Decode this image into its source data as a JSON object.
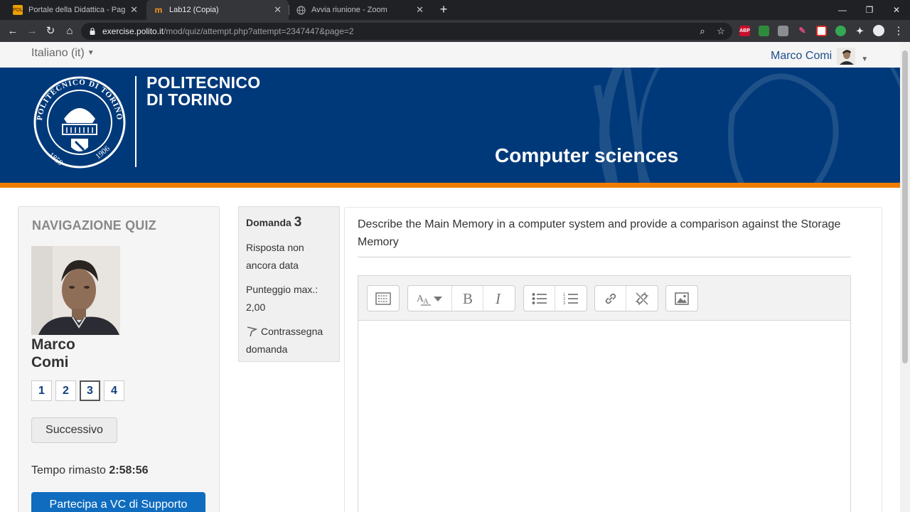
{
  "browser": {
    "tabs": [
      {
        "title": "Portale della Didattica - Pagina di",
        "favicon": "POL",
        "active": false
      },
      {
        "title": "Lab12 (Copia)",
        "favicon": "m",
        "active": true
      },
      {
        "title": "Avvia riunione - Zoom",
        "favicon": "globe-icon",
        "active": false
      }
    ],
    "url_host": "exercise.polito.it",
    "url_path": "/mod/quiz/attempt.php?attempt=2347447&page=2"
  },
  "topbar": {
    "language": "Italiano (it)",
    "user_name": "Marco Comi"
  },
  "banner": {
    "org_line1": "POLITECNICO",
    "org_line2": "DI TORINO",
    "seal_text": "POLITECNICO DI TORINO",
    "seal_year_left": "1859",
    "seal_year_right": "1906",
    "course_title": "Computer sciences",
    "brand_color": "#003979",
    "stripe_color": "#ef7d00"
  },
  "quiz_nav": {
    "heading": "NAVIGAZIONE QUIZ",
    "student_first": "Marco",
    "student_last": "Comi",
    "questions": [
      "1",
      "2",
      "3",
      "4"
    ],
    "current_question": "3",
    "next_label": "Successivo",
    "timer_label": "Tempo rimasto",
    "timer_value": "2:58:56",
    "vc_button": "Partecipa a VC di Supporto"
  },
  "question_info": {
    "label": "Domanda",
    "number": "3",
    "state": "Risposta non ancora data",
    "grade": "Punteggio max.: 2,00",
    "flag": "Contrassegna domanda"
  },
  "question": {
    "text": "Describe the Main Memory in a computer system and provide a comparison against the Storage Memory",
    "editor_tools": [
      "toolbar-toggle-icon",
      "font-size-icon",
      "bold-icon",
      "italic-icon",
      "bullet-list-icon",
      "numbered-list-icon",
      "link-icon",
      "unlink-icon",
      "image-icon"
    ],
    "answer": ""
  }
}
